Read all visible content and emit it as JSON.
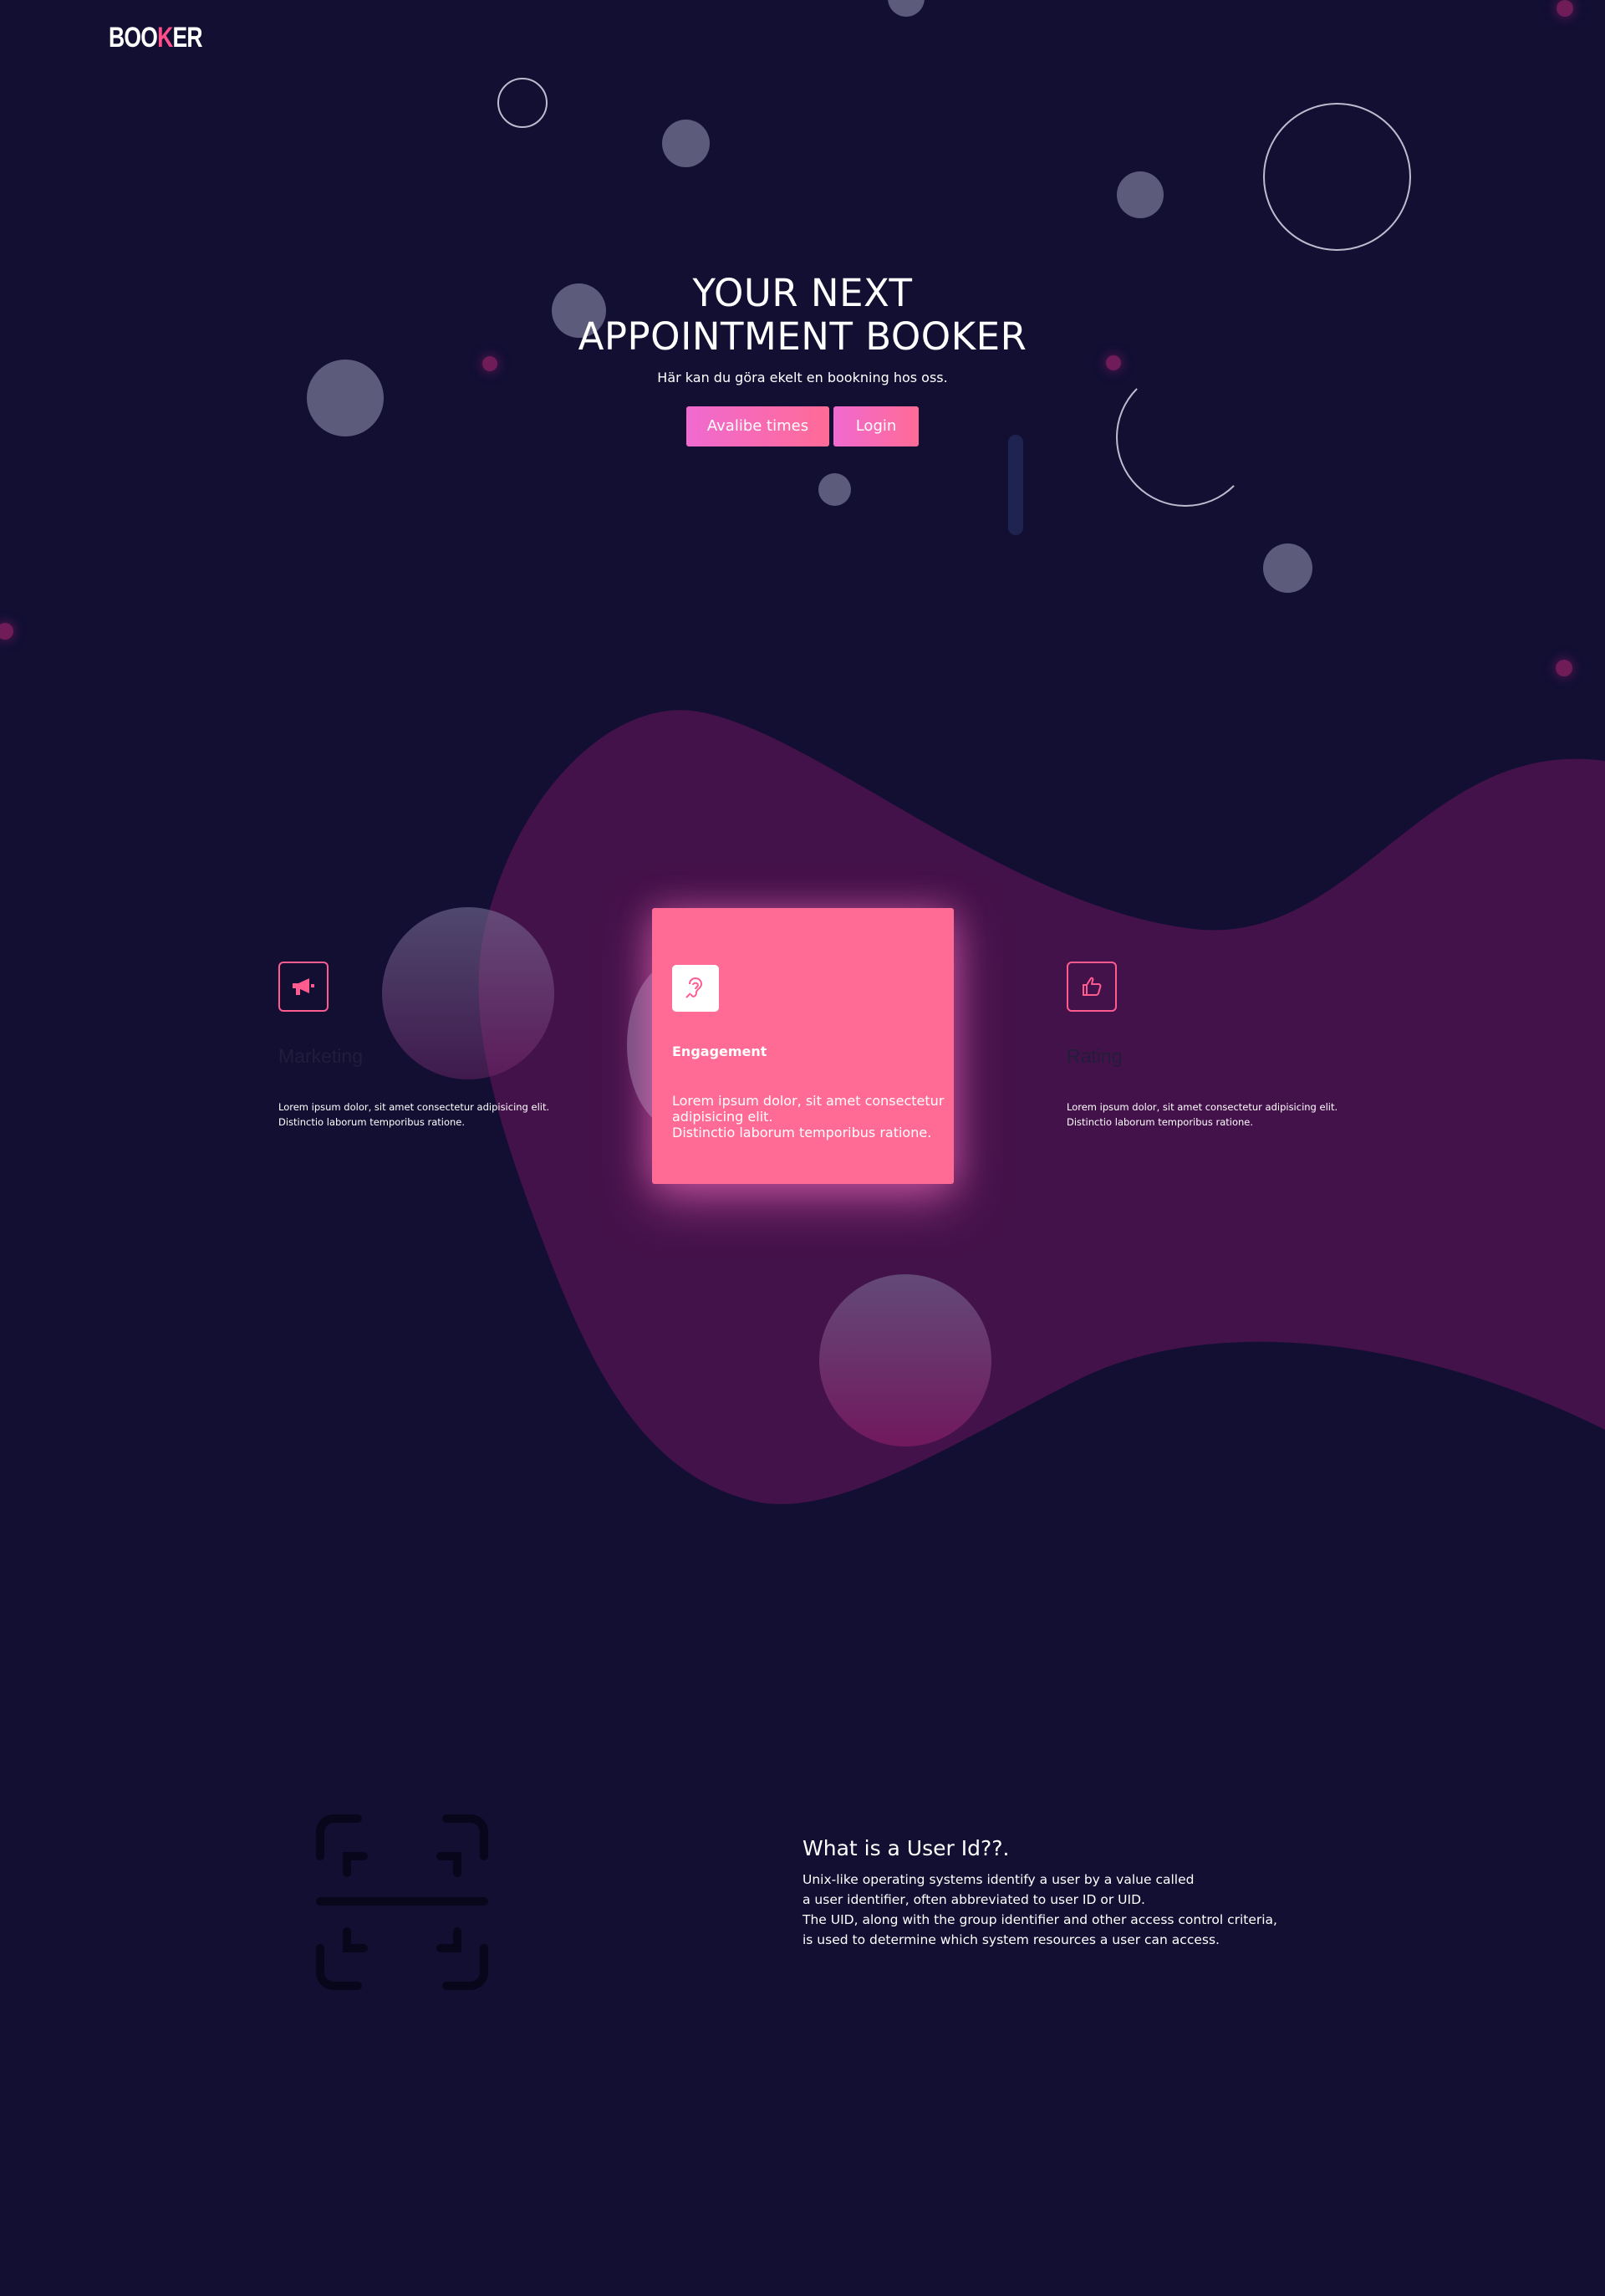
{
  "brand": {
    "logo_prefix": "BOO",
    "logo_accent": "K",
    "logo_suffix": "ER"
  },
  "hero": {
    "title_line1": "YOUR NEXT",
    "title_line2": "APPOINTMENT BOOKER",
    "subtitle": "Här kan du göra ekelt en bookning hos oss.",
    "buttons": {
      "available": "Avalibe times",
      "login": "Login"
    }
  },
  "features": [
    {
      "icon": "megaphone-icon",
      "title": "Marketing",
      "desc_line1": "Lorem ipsum dolor, sit amet consectetur adipisicing elit.",
      "desc_line2": "Distinctio laborum temporibus ratione."
    },
    {
      "icon": "ear-icon",
      "title": "Engagement",
      "desc_line1": "Lorem ipsum dolor, sit amet consectetur adipisicing elit.",
      "desc_line2": "Distinctio laborum temporibus ratione."
    },
    {
      "icon": "thumbs-up-icon",
      "title": "Rating",
      "desc_line1": "Lorem ipsum dolor, sit amet consectetur adipisicing elit.",
      "desc_line2": "Distinctio laborum temporibus ratione."
    }
  ],
  "user_id": {
    "icon": "scan-icon",
    "title": "What is a User Id??.",
    "lines": [
      "Unix-like operating systems identify a user by a value called",
      "a user identifier, often abbreviated to user ID or UID.",
      "The UID, along with the group identifier and other access control criteria,",
      "is used to determine which system resources a user can access."
    ]
  },
  "colors": {
    "background": "#120f33",
    "accent": "#ff6b94",
    "blob": "#44124a",
    "bubble": "#8c8aa8"
  }
}
